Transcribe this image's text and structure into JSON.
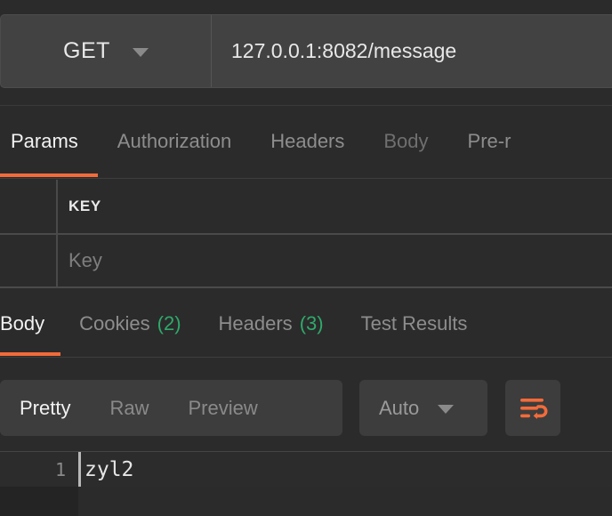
{
  "request": {
    "method": "GET",
    "method_caret_icon": "chevron-down-icon",
    "url": "127.0.0.1:8082/message",
    "tabs": [
      {
        "label": "Params",
        "active": true
      },
      {
        "label": "Authorization",
        "active": false
      },
      {
        "label": "Headers",
        "active": false
      },
      {
        "label": "Body",
        "active": false,
        "dim": true
      },
      {
        "label": "Pre-r",
        "active": false
      }
    ],
    "params_table": {
      "columns": [
        "KEY"
      ],
      "rows": [
        {
          "key_placeholder": "Key",
          "key_value": ""
        }
      ]
    }
  },
  "response": {
    "tabs": [
      {
        "label": "Body",
        "count": "",
        "active": true
      },
      {
        "label": "Cookies",
        "count": "(2)",
        "active": false
      },
      {
        "label": "Headers",
        "count": "(3)",
        "active": false
      },
      {
        "label": "Test Results",
        "count": "",
        "active": false
      }
    ],
    "view_modes": [
      {
        "label": "Pretty",
        "active": true
      },
      {
        "label": "Raw",
        "active": false
      },
      {
        "label": "Preview",
        "active": false
      }
    ],
    "format_select": {
      "value": "Auto",
      "caret_icon": "chevron-down-icon"
    },
    "wrap_button": {
      "icon": "word-wrap-icon"
    },
    "body": {
      "lines": [
        {
          "number": "1",
          "text": "zyl2"
        }
      ]
    }
  },
  "colors": {
    "accent": "#f26b3a",
    "count_green": "#2fa96b",
    "background": "#2b2b2b",
    "panel": "#424242",
    "editor_bg": "#242424"
  }
}
